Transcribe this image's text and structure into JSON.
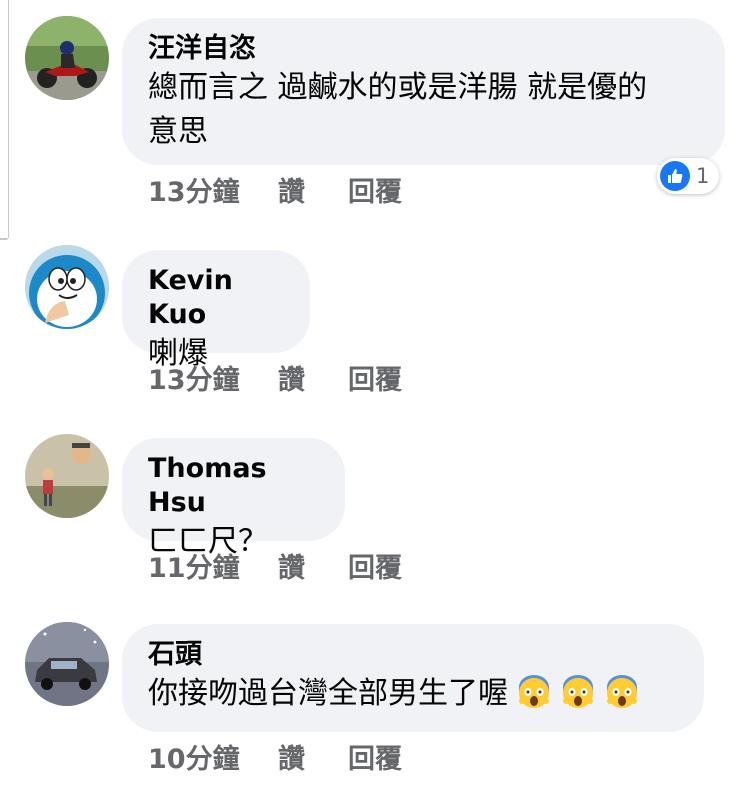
{
  "comments": [
    {
      "author": "汪洋自恣",
      "text": "總而言之 過鹹水的或是洋腸 就是優的",
      "text_line2": "意思",
      "time": "13分鐘",
      "like": "讚",
      "reply": "回覆",
      "reaction_count": "1"
    },
    {
      "author": "Kevin Kuo",
      "text": "喇爆",
      "time": "13分鐘",
      "like": "讚",
      "reply": "回覆"
    },
    {
      "author": "Thomas Hsu",
      "text": "ㄈㄈ尺？",
      "time": "11分鐘",
      "like": "讚",
      "reply": "回覆"
    },
    {
      "author": "石頭",
      "text": "你接吻過台灣全部男生了喔",
      "emojis": [
        "screaming-face",
        "screaming-face",
        "screaming-face"
      ],
      "time": "10分鐘",
      "like": "讚",
      "reply": "回覆"
    }
  ],
  "colors": {
    "bubble": "#f0f2f5",
    "meta_text": "#65676b",
    "like_blue": "#1877f2"
  }
}
